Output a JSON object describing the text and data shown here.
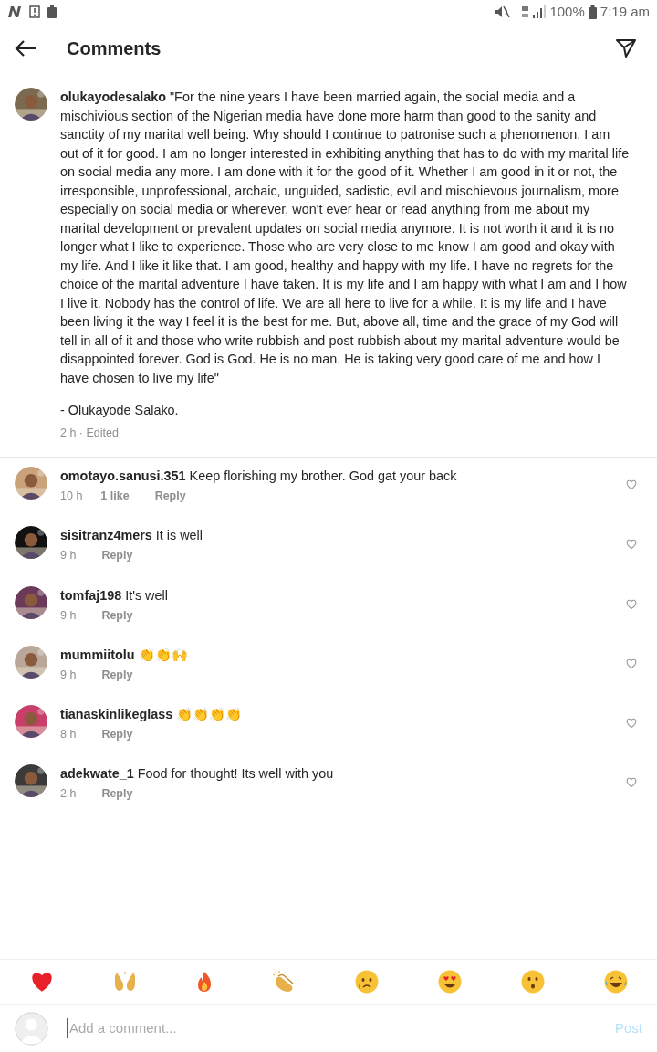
{
  "status_bar": {
    "battery": "100%",
    "time": "7:19 am"
  },
  "header": {
    "title": "Comments"
  },
  "caption": {
    "username": "olukayodesalako",
    "text": "\"For the nine years I have been married again, the social media and a mischivious section of the Nigerian media have done more harm than good to the sanity and sanctity of my marital well being. Why should I continue to patronise such a phenomenon. I am out of it for good. I am no longer interested in exhibiting anything that has to do with my marital life on social media any more. I am done with it for the good of it. Whether I am good in it or not, the irresponsible, unprofessional, archaic, unguided, sadistic, evil and mischievous journalism, more especially on social media or wherever, won't ever hear or read anything from me about my marital development or prevalent updates on social media anymore. It is not worth it and it is no longer what I like to experience. Those who are very close to me know I am good and okay with my life. And I like it like that. I am good, healthy and happy with my life. I have no regrets for the choice of the marital adventure I have taken. It is my life and I am happy with what I am and I how I live it. Nobody has the control of life. We are all here to live for a while. It is my life and I have been living it the way I feel it is the best for me. But, above all, time and the grace of my God will tell in all of it and those who write rubbish and post rubbish about my marital adventure would be disappointed forever. God is God. He is no man. He is taking very good care of me and how I have chosen to live my life\"",
    "signature": "- Olukayode Salako.",
    "meta": "2 h · Edited"
  },
  "comments": [
    {
      "username": "omotayo.sanusi.351",
      "text": "Keep florishing my brother. God gat your back",
      "time": "10 h",
      "likes": "1 like",
      "reply": "Reply"
    },
    {
      "username": "sisitranz4mers",
      "text": "It is well",
      "time": "9 h",
      "reply": "Reply"
    },
    {
      "username": "tomfaj198",
      "text": "It's well",
      "time": "9 h",
      "reply": "Reply"
    },
    {
      "username": "mummiitolu",
      "text": "👏👏🙌",
      "time": "9 h",
      "reply": "Reply"
    },
    {
      "username": "tianaskinlikeglass",
      "text": "👏👏👏👏",
      "time": "8 h",
      "reply": "Reply"
    },
    {
      "username": "adekwate_1",
      "text": "Food for thought! Its well with you",
      "time": "2 h",
      "reply": "Reply"
    }
  ],
  "composer": {
    "placeholder": "Add a comment...",
    "post": "Post"
  }
}
